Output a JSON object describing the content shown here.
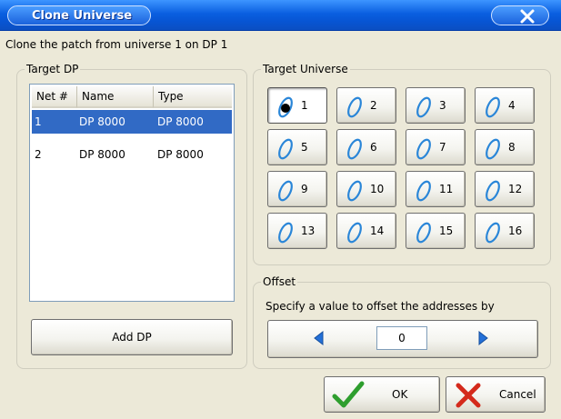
{
  "window": {
    "title": "Clone Universe"
  },
  "subtitle": "Clone the patch from universe 1 on DP 1",
  "target_dp": {
    "label": "Target DP",
    "columns": [
      "Net #",
      "Name",
      "Type"
    ],
    "rows": [
      {
        "net": "1",
        "name": "DP 8000",
        "type": "DP 8000",
        "selected": true
      },
      {
        "net": "2",
        "name": "DP 8000",
        "type": "DP 8000",
        "selected": false
      }
    ],
    "add_button": "Add DP"
  },
  "target_universe": {
    "label": "Target Universe",
    "selected": "1",
    "buttons": [
      "1",
      "2",
      "3",
      "4",
      "5",
      "6",
      "7",
      "8",
      "9",
      "10",
      "11",
      "12",
      "13",
      "14",
      "15",
      "16"
    ]
  },
  "offset": {
    "label": "Offset",
    "description": "Specify a value to offset the addresses by",
    "value": "0"
  },
  "footer": {
    "ok_label": "OK",
    "cancel_label": "Cancel"
  },
  "colors": {
    "title_bar": "#0a5fe0",
    "selection": "#316ac5",
    "ok_check": "#2e9e2e",
    "cancel_x": "#d42a1c",
    "arrow": "#2470d8"
  }
}
